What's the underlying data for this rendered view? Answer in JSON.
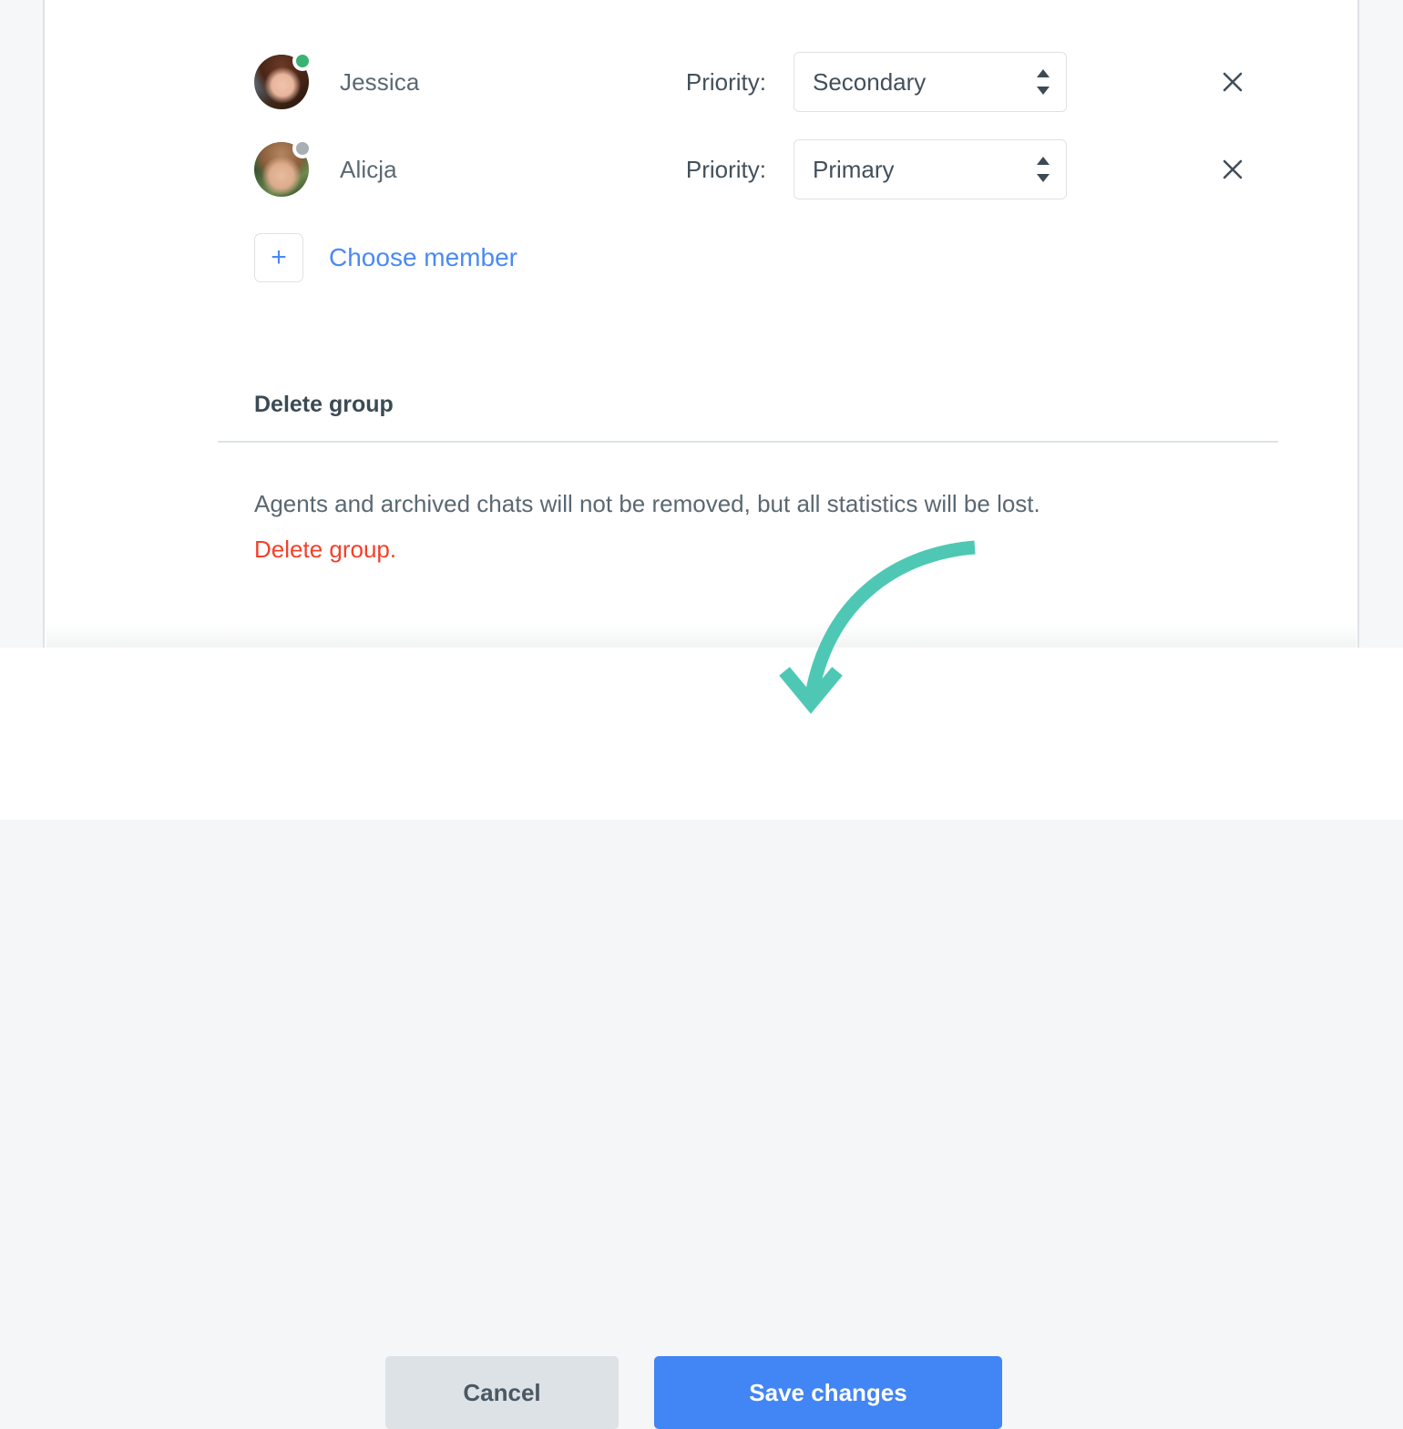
{
  "modal": {
    "members": [
      {
        "name": "Jessica",
        "avatar_icon": "avatar-photo-jessica",
        "status": "online",
        "status_color": "#3bb273",
        "priority_label": "Priority:",
        "priority_value": "Secondary",
        "priority_options": [
          "Primary",
          "Secondary"
        ],
        "remove_icon": "close-x-icon"
      },
      {
        "name": "Alicja",
        "avatar_icon": "avatar-photo-alicja",
        "status": "offline",
        "status_color": "#a9aeb3",
        "priority_label": "Priority:",
        "priority_value": "Primary",
        "priority_options": [
          "Primary",
          "Secondary"
        ],
        "remove_icon": "close-x-icon"
      }
    ],
    "choose_member": {
      "add_icon": "plus-icon",
      "add_symbol": "+",
      "link_label": "Choose member",
      "link_color": "#4a8af4"
    },
    "delete_section": {
      "title": "Delete group",
      "description": "Agents and archived chats will not be removed, but all statistics will be lost.",
      "delete_link": "Delete group.",
      "delete_link_color": "#f4402a"
    },
    "footer": {
      "cancel_label": "Cancel",
      "save_label": "Save changes",
      "save_color": "#4285f4",
      "cancel_color": "#dde2e6"
    }
  },
  "annotation": {
    "arrow_icon": "curved-down-arrow-annotation",
    "arrow_color": "#4ec8b4",
    "points_to": "Save changes"
  }
}
